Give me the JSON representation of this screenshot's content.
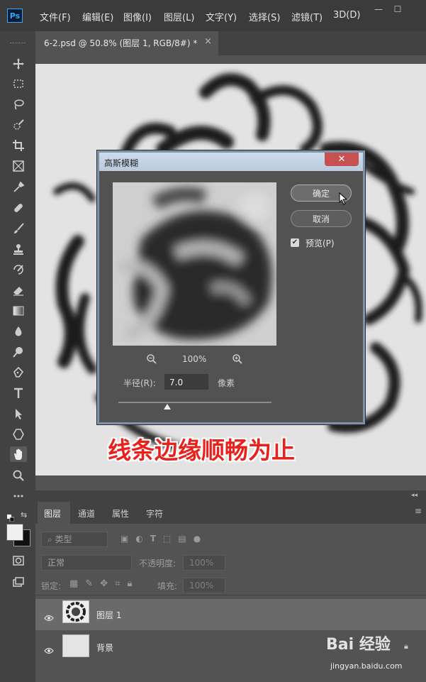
{
  "app": {
    "logo": "Ps"
  },
  "menu": [
    "文件(F)",
    "编辑(E)",
    "图像(I)",
    "图层(L)",
    "文字(Y)",
    "选择(S)",
    "滤镜(T)",
    "3D(D)"
  ],
  "window_controls": [
    "—",
    "☐"
  ],
  "document_tab": {
    "title": "6-2.psd @ 50.8% (图层 1, RGB/8#) *",
    "close": "×"
  },
  "tools": [
    "move-icon",
    "marquee-icon",
    "lasso-icon",
    "quick-select-icon",
    "crop-icon",
    "frame-icon",
    "eyedropper-icon",
    "healing-icon",
    "brush-icon",
    "stamp-icon",
    "history-brush-icon",
    "eraser-icon",
    "gradient-icon",
    "blur-icon",
    "dodge-icon",
    "pen-icon",
    "type-icon",
    "path-select-icon",
    "shape-icon",
    "hand-icon",
    "zoom-icon",
    "more-icon"
  ],
  "dialog": {
    "title": "高斯模糊",
    "close": "✕",
    "ok_label": "确定",
    "cancel_label": "取消",
    "preview_label": "预览(P)",
    "preview_checked": true,
    "zoom_level": "100%",
    "radius_label": "半径(R):",
    "radius_value": "7.0",
    "radius_unit": "像素"
  },
  "caption": "线条边缘顺畅为止",
  "panel": {
    "tabs": [
      "图层",
      "通道",
      "属性",
      "字符"
    ],
    "filter_kind": "类型",
    "blend_mode": "正常",
    "opacity_label": "不透明度:",
    "opacity_value": "100%",
    "lock_label": "锁定:",
    "fill_label": "填充:",
    "fill_value": "100%",
    "layers": [
      {
        "name": "图层 1"
      },
      {
        "name": "背景"
      }
    ]
  },
  "watermark": {
    "brand": "Bai  经验",
    "url": "jingyan.baidu.com"
  }
}
